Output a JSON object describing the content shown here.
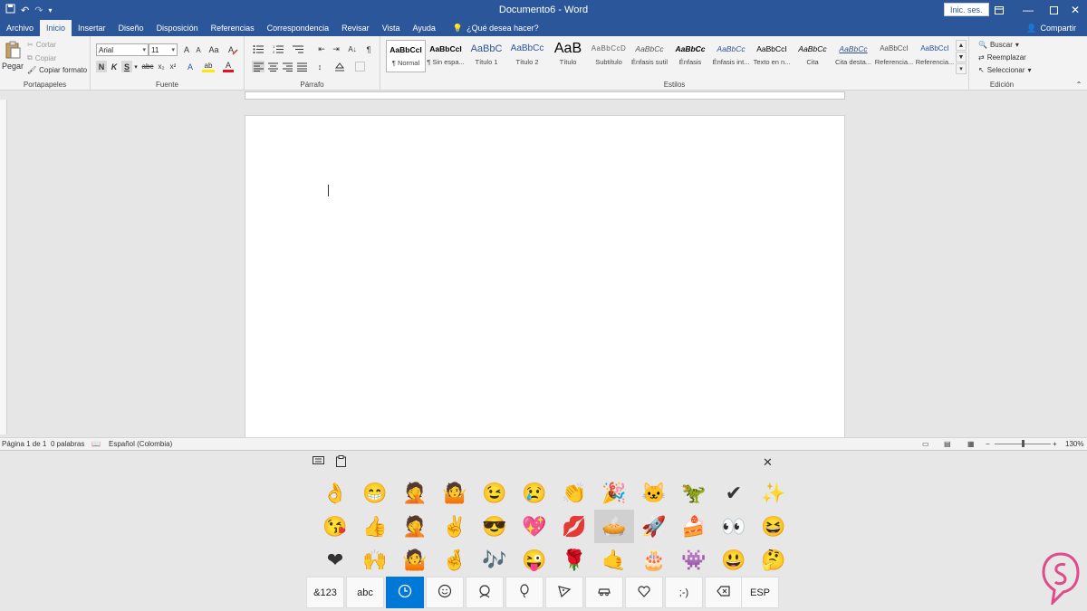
{
  "title_bar": {
    "doc_title": "Documento6  -  Word",
    "signin_label": "Inic. ses.",
    "qat_icons": [
      "save-icon",
      "undo-icon",
      "redo-icon",
      "customize-icon"
    ],
    "window_controls": [
      "ribbon-display-icon",
      "minimize-icon",
      "maximize-icon",
      "close-icon"
    ]
  },
  "tabs": [
    {
      "label": "Archivo"
    },
    {
      "label": "Inicio",
      "active": true
    },
    {
      "label": "Insertar"
    },
    {
      "label": "Diseño"
    },
    {
      "label": "Disposición"
    },
    {
      "label": "Referencias"
    },
    {
      "label": "Correspondencia"
    },
    {
      "label": "Revisar"
    },
    {
      "label": "Vista"
    },
    {
      "label": "Ayuda"
    }
  ],
  "tell_me": "¿Qué desea hacer?",
  "share_label": "Compartir",
  "clipboard": {
    "group_label": "Portapapeles",
    "paste_label": "Pegar",
    "cut_label": "Cortar",
    "copy_label": "Copiar",
    "format_painter_label": "Copiar formato"
  },
  "font": {
    "group_label": "Fuente",
    "font_name": "Arial",
    "font_size": "11",
    "grow": "A",
    "shrink": "A",
    "case": "Aa",
    "bold": "N",
    "italic": "K",
    "underline": "S",
    "strike": "abc",
    "sub": "x₂",
    "sup": "x²",
    "effects": "A",
    "highlight": "ab",
    "color": "A"
  },
  "paragraph": {
    "group_label": "Párrafo",
    "pilcrow": "¶"
  },
  "styles": {
    "group_label": "Estilos",
    "items": [
      {
        "preview": "AaBbCcI",
        "name": "¶ Normal",
        "selected": true
      },
      {
        "preview": "AaBbCcI",
        "name": "¶ Sin espa..."
      },
      {
        "preview": "AaBbC",
        "name": "Título 1"
      },
      {
        "preview": "AaBbCc",
        "name": "Título 2"
      },
      {
        "preview": "AaB",
        "name": "Título"
      },
      {
        "preview": "AaBbCcD",
        "name": "Subtítulo"
      },
      {
        "preview": "AaBbCc",
        "name": "Énfasis sutil"
      },
      {
        "preview": "AaBbCc",
        "name": "Énfasis"
      },
      {
        "preview": "AaBbCc",
        "name": "Énfasis int..."
      },
      {
        "preview": "AaBbCcI",
        "name": "Texto en n..."
      },
      {
        "preview": "AaBbCc",
        "name": "Cita"
      },
      {
        "preview": "AaBbCc",
        "name": "Cita desta..."
      },
      {
        "preview": "AaBbCcI",
        "name": "Referencia..."
      },
      {
        "preview": "AaBbCcI",
        "name": "Referencia..."
      }
    ]
  },
  "editing": {
    "group_label": "Edición",
    "find_label": "Buscar",
    "replace_label": "Reemplazar",
    "select_label": "Seleccionar"
  },
  "status": {
    "page": "Página 1 de 1",
    "words": "0 palabras",
    "language": "Español (Colombia)",
    "zoom": "130%",
    "zoom_minus": "−",
    "zoom_plus": "+"
  },
  "keyboard": {
    "close": "✕",
    "emojis": [
      "👌",
      "😁",
      "🤦",
      "🤷",
      "😉",
      "😢",
      "👏",
      "🎉",
      "🐱",
      "🦖",
      "✔",
      "✨",
      "😘",
      "👍",
      "🤦",
      "✌",
      "😎",
      "💖",
      "💋",
      "🥧",
      "🚀",
      "🍰",
      "👀",
      "😆",
      "❤",
      "🙌",
      "🤷",
      "🤞",
      "🎶",
      "😜",
      "🌹",
      "🤙",
      "🎂",
      "👾",
      "😃",
      "🤔"
    ],
    "highlight_index": 19,
    "keys": [
      {
        "label": "&123"
      },
      {
        "label": "abc"
      },
      {
        "label": "",
        "icon": "clock-icon",
        "active": true
      },
      {
        "label": "",
        "icon": "smiley-icon"
      },
      {
        "label": "",
        "icon": "person-icon"
      },
      {
        "label": "",
        "icon": "balloon-icon"
      },
      {
        "label": "",
        "icon": "pizza-icon"
      },
      {
        "label": "",
        "icon": "car-icon"
      },
      {
        "label": "",
        "icon": "heart-icon"
      },
      {
        "label": ";-)"
      },
      {
        "label": "",
        "icon": "backspace-icon"
      },
      {
        "label": "ESP"
      }
    ]
  }
}
